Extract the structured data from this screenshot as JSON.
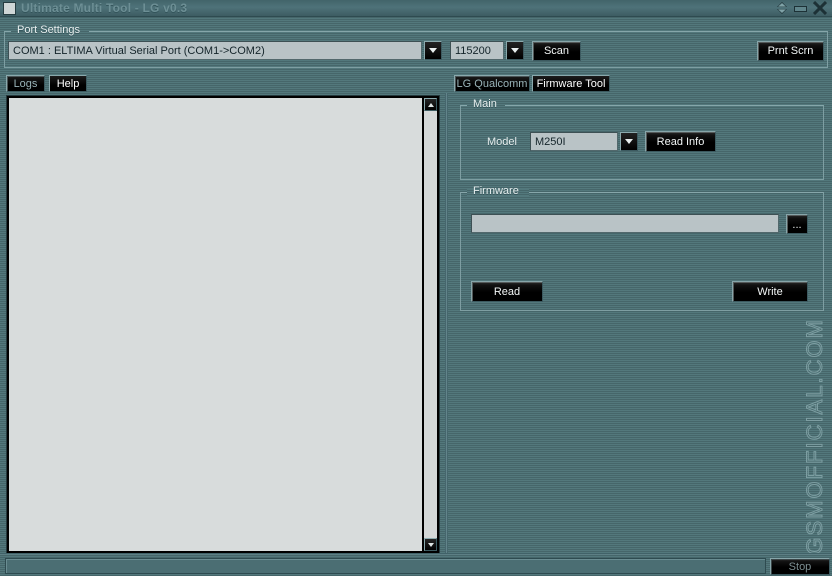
{
  "window": {
    "title": "Ultimate Multi Tool - LG v0.3",
    "icon": "document-lines-icon",
    "controls": [
      {
        "name": "rollup-button",
        "glyph": "updown-arrows"
      },
      {
        "name": "minimize-button",
        "glyph": "minimize-bar"
      },
      {
        "name": "close-button",
        "glyph": "close-x"
      }
    ]
  },
  "port_settings": {
    "legend": "Port Settings",
    "com_port": {
      "value": "COM1 : ELTIMA Virtual Serial Port (COM1->COM2)",
      "placeholder": ""
    },
    "baud_rate": {
      "value": "115200",
      "placeholder": ""
    },
    "scan_label": "Scan",
    "print_screen_label": "Prnt Scrn"
  },
  "left_panel": {
    "tabs": [
      {
        "label": "Logs",
        "active": true
      },
      {
        "label": "Help",
        "active": false
      }
    ],
    "log_text": "",
    "scrollbar": {
      "up": "scroll-up-icon",
      "down": "scroll-down-icon"
    }
  },
  "right_panel": {
    "tabs": [
      {
        "label": "LG Qualcomm",
        "active": false
      },
      {
        "label": "Firmware Tool",
        "active": true
      }
    ],
    "main_group": {
      "legend": "Main",
      "model_label": "Model",
      "model_value": "M250I",
      "read_info_label": "Read Info"
    },
    "firmware_group": {
      "legend": "Firmware",
      "path_value": "",
      "path_placeholder": "",
      "browse_label": "...",
      "read_label": "Read",
      "write_label": "Write"
    }
  },
  "watermark": "GSMOFFICIAL.COM",
  "status_bar": {
    "progress_value": "",
    "stop_label": "Stop"
  },
  "colors": {
    "skin_light": "#53787c",
    "skin_dark": "#46666a",
    "button_face": "#000000",
    "button_text": "#f2f6f6",
    "field_face": "#b9c3c6",
    "log_face": "#d8dcdc",
    "frame_line": "#7e9ea2",
    "title_text": "#6d8f95"
  }
}
